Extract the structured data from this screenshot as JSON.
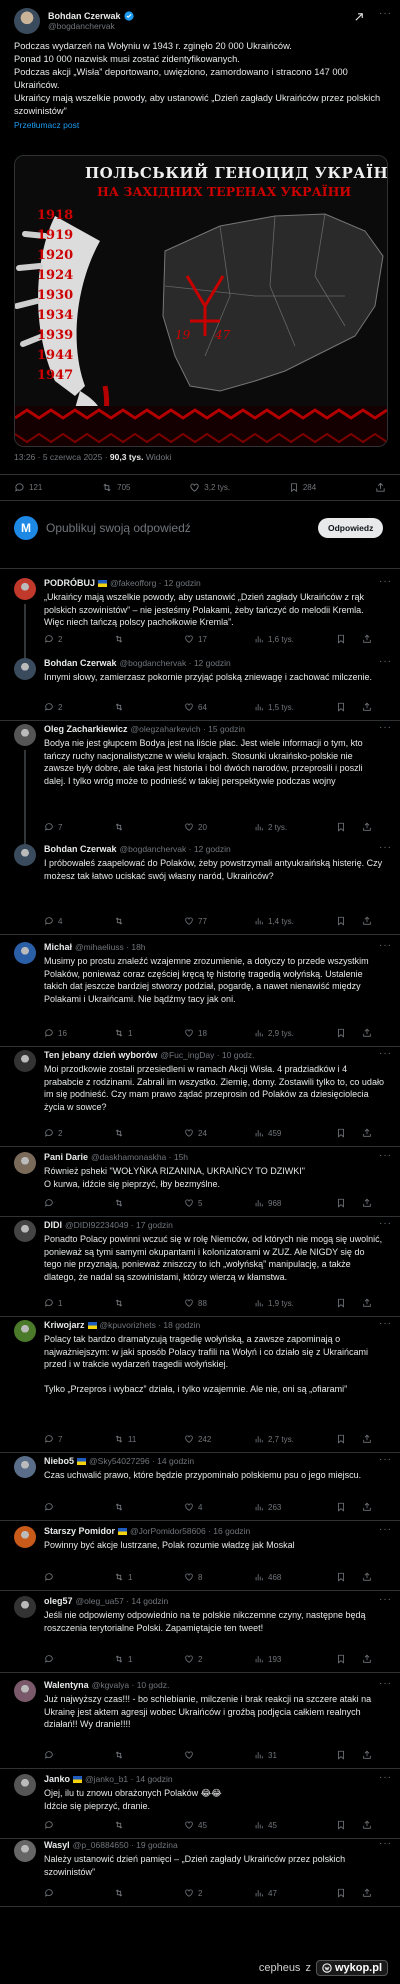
{
  "post": {
    "author_name": "Bohdan Czerwak",
    "author_handle": "@bogdanchervak",
    "text_lines": [
      "Podczas wydarzeń na Wołyniu w 1943 r. zginęło 20 000 Ukraińców.",
      "Ponad 10 000 nazwisk musi zostać zidentyfikowanych.",
      "Podczas akcji „Wisła” deportowano, uwięziono, zamordowano i stracono 147 000 Ukraińców.",
      "Ukraińcy mają wszelkie powody, aby ustanowić „Dzień zagłady Ukraińców przez polskich szowinistów”"
    ],
    "translate_label": "Przetłumacz post",
    "poster_title_1": "ПОЛЬСЬКИЙ ГЕНОЦИД УКРАЇНЦІВ",
    "poster_title_2": "НА ЗАХІДНИХ ТЕРЕНАХ УКРАЇНИ",
    "poster_years": [
      "1918",
      "1919",
      "1920",
      "1924",
      "1930",
      "1934",
      "1939",
      "1944",
      "1947"
    ],
    "poster_date_a": "19",
    "poster_date_b": "47",
    "timestamp": "13:26 · 5 czerwca 2025 · ",
    "views_count": "90,3 tys.",
    "views_label": "Widoki",
    "stats": {
      "replies": "121",
      "reposts": "705",
      "likes": "3,2 tys.",
      "bookmarks": "284"
    }
  },
  "reply_box": {
    "avatar_letter": "M",
    "placeholder": "Opublikuj swoją odpowiedź",
    "button_label": "Odpowiedz"
  },
  "replies": [
    {
      "name": "PODRÓBUJ",
      "handle": "@fakeofforg · 12 godzin",
      "text": "„Ukraińcy mają wszelkie powody, aby ustanowić „Dzień zagłady Ukraińców z rąk polskich szowinistów” – nie jesteśmy Polakami, żeby tańczyć do melodii Kremla. Więc niech tańczą polscy pachołkowie Kremla”.",
      "replies": "2",
      "reposts": "",
      "likes": "17",
      "views": "1,6 tys."
    },
    {
      "name": "Bohdan Czerwak",
      "handle": "@bogdanchervak · 12 godzin",
      "text": "Innymi słowy, zamierzasz pokornie przyjąć polską zniewagę i zachować milczenie.",
      "replies": "2",
      "reposts": "",
      "likes": "64",
      "views": "1,5 tys."
    },
    {
      "name": "Oleg Zacharkiewicz",
      "handle": "@olegzaharkevich · 15 godzin",
      "text": "Bodya nie jest głupcem Bodya jest na liście płac. Jest wiele informacji o tym, kto tańczy ruchy nacjonalistyczne w wielu krajach. Stosunki ukraińsko-polskie nie zawsze były dobre, ale taka jest historia i ból dwóch narodów, przeprosili i poszli dalej. I tylko wróg może to podnieść w takiej perspektywie podczas wojny",
      "replies": "7",
      "reposts": "",
      "likes": "20",
      "views": "2 tys."
    },
    {
      "name": "Bohdan Czerwak",
      "handle": "@bogdanchervak · 12 godzin",
      "text": "I próbowałeś zaapelować do Polaków, żeby powstrzymali antyukraińską histerię. Czy możesz tak łatwo uciskać swój własny naród, Ukraińców?",
      "replies": "4",
      "reposts": "",
      "likes": "77",
      "views": "1,4 tys."
    },
    {
      "name": "Michał",
      "handle": "@mihaeliuss · 18h",
      "text": "Musimy po prostu znaleźć wzajemne zrozumienie, a dotyczy to przede wszystkim Polaków, ponieważ coraz częściej kręcą tę historię tragedią wołyńską. Ustalenie takich dat jeszcze bardziej stworzy podział, pogardę, a nawet nienawiść między Polakami i Ukraińcami. Nie bądźmy tacy jak oni.",
      "replies": "16",
      "reposts": "1",
      "likes": "18",
      "views": "2,9 tys."
    },
    {
      "name": "Ten jebany dzień wyborów",
      "handle": "@Fuc_ingDay · 10 godz.",
      "text": "Moi przodkowie zostali przesiedleni w ramach Akcji Wisła. 4 pradziadków i 4 prababcie z rodzinami. Zabrali im wszystko. Ziemię, domy. Zostawili tylko to, co udało im się podnieść. Czy mam prawo żądać przeprosin od Polaków za dziesięciolecia życia w sowce?",
      "replies": "2",
      "reposts": "",
      "likes": "24",
      "views": "459"
    },
    {
      "name": "Pani Darie",
      "handle": "@daskhamonaskha · 15h",
      "text": "Również pshekі \"WOŁYŃKA RIZANINA, UKRAIŃCY TO DZIWKI\"\nO kurwa, idźcie się pieprzyć, łby bezmyślne.",
      "replies": "",
      "reposts": "",
      "likes": "5",
      "views": "968"
    },
    {
      "name": "DIDI",
      "handle": "@DIDI92234049 · 17 godzin",
      "text": "Ponadto Polacy powinni wczuć się w rolę Niemców, od których nie mogą się uwolnić, ponieważ są tymi samymi okupantami i kolonizatorami w ZUZ. Ale NIGDY się do tego nie przyznają, ponieważ zniszczy to ich „wołyńską” manipulację, a także dlatego, że nadal są szowinistami, którzy wierzą w kłamstwa.",
      "replies": "1",
      "reposts": "",
      "likes": "88",
      "views": "1,9 tys."
    },
    {
      "name": "Kriwojarz",
      "handle": "@kpuvorizhets · 18 godzin",
      "text": "Polacy tak bardzo dramatyzują tragedię wołyńską, a zawsze zapominają o najważniejszym: w jaki sposób Polacy trafili na Wołyń i co działo się z Ukraińcami przed i w trakcie wydarzeń tragedii wołyńskiej.\n\nTylko „Przepros i wybacz” działa, i tylko wzajemnie. Ale nie, oni są „ofiarami”",
      "replies": "7",
      "reposts": "11",
      "likes": "242",
      "views": "2,7 tys."
    },
    {
      "name": "Niebo5",
      "handle": "@Sky54027296 · 14 godzin",
      "text": "Czas uchwalić prawo, które będzie przypominało polskiemu psu o jego miejscu.",
      "replies": "",
      "reposts": "",
      "likes": "4",
      "views": "263"
    },
    {
      "name": "Starszy Pomidor",
      "handle": "@JorPomidor58606 · 16 godzin",
      "text": "Powinny być akcje lustrzane, Polak rozumie władzę jak Moskal",
      "replies": "",
      "reposts": "1",
      "likes": "8",
      "views": "468"
    },
    {
      "name": "oleg57",
      "handle": "@oleg_ua57 · 14 godzin",
      "text": "Jeśli nie odpowiemy odpowiednio na te polskie nikczemne czyny, następne będą roszczenia terytorialne Polski. Zapamiętajcie ten tweet!",
      "replies": "",
      "reposts": "1",
      "likes": "2",
      "views": "193"
    },
    {
      "name": "Walentyna",
      "handle": "@kgvalya · 10 godz.",
      "text": "Już najwyższy czas!!! - bo schlebianie, milczenie i brak reakcji na szczere ataki na Ukrainę jest aktem agresji wobec Ukraińców i groźbą podjęcia całkiem realnych działań!! Wy dranie!!!!",
      "replies": "",
      "reposts": "",
      "likes": "",
      "views": "31"
    },
    {
      "name": "Janko",
      "handle": "@janko_b1 · 14 godzin",
      "text": "Ojej, ilu tu znowu obrażonych Polaków 😂😂\nIdźcie się pieprzyć, dranie.",
      "replies": "",
      "reposts": "",
      "likes": "45",
      "views": "45"
    },
    {
      "name": "Wasyl",
      "handle": "@p_06884650 · 19 godzina",
      "text": "Należy ustanowić dzień pamięci – „Dzień zagłady Ukraińców przez polskich szowinistów”",
      "replies": "",
      "reposts": "",
      "likes": "2",
      "views": "47"
    }
  ],
  "footer": {
    "watermark_user": "cepheus",
    "watermark_z": "z",
    "watermark_site": "wykop.pl"
  },
  "colors": {
    "accent": "#1d9bf0",
    "verified": "#1d9bf0",
    "bg": "#000000",
    "text": "#e7e9ea",
    "muted": "#71767b",
    "divider": "#2f3336"
  }
}
